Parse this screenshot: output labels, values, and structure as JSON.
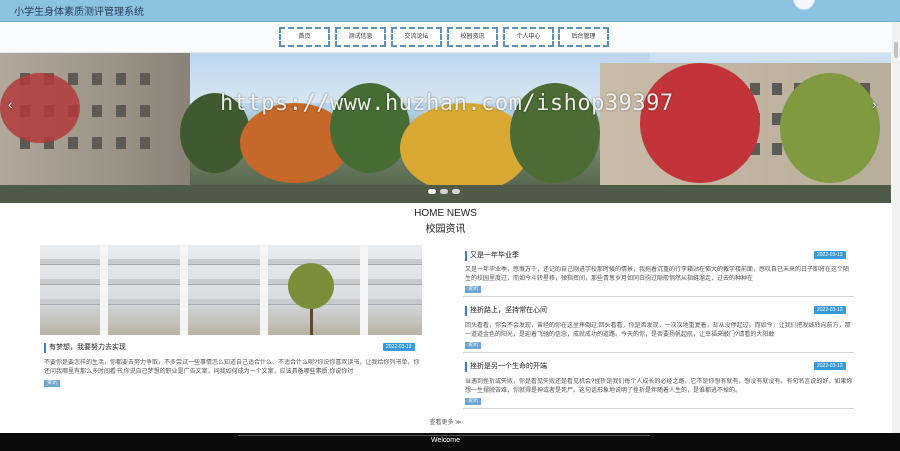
{
  "header": {
    "site_title": "小学生身体素质测评管理系统"
  },
  "nav": {
    "items": [
      "首页",
      "测试信息",
      "交流论坛",
      "校园资讯",
      "个人中心",
      "后台管理"
    ]
  },
  "banner": {
    "watermark": "https://www.huzhan.com/ishop39397",
    "prev_glyph": "‹",
    "next_glyph": "›",
    "slide_count": 3
  },
  "section": {
    "title_en": "HOME NEWS",
    "title_cn": "校园资讯"
  },
  "featured": {
    "title": "有梦想，我要努力去实现",
    "date": "2022-03-13",
    "excerpt": "不要你是要怎样的生活，你都要去努力争取，不多尝试一些事情怎么知道自己适合什么、不适合什么呢?你说你喜欢读书，让我给你列书单，你还问我哪里有那么多时间看书;你说自己梦想的职业是广告文案，问我如何成为一个文案，应该具备哪些素质;你说你讨",
    "tag": "资讯"
  },
  "news": [
    {
      "title": "又是一年毕业季",
      "date": "2022-03-13",
      "excerpt": "又是一年毕业季，感慨万千，还记的自己刚进学校那时候的情景，我拖着沉重的行李箱站在偌大的教学楼前面，感叹自己未来的日子即将在这个陌生的校园里度过，而如今斗转星移，弹指挥间，那些青葱岁月如同白驹过隙般悄然从指缝溜走，过去的种种在",
      "tag": "资讯"
    },
    {
      "title": "挫折路上，坚持常在心间",
      "date": "2022-03-13",
      "excerpt": "回头看看，你会不会发现，曾经的你在这里摔倒过;回头看看，你是否发现，一次次地重复着，却从没停起过。而如今，让我们把视线转向前方，那一道道金色的阳光，是迎着飞驰的信念，成就成功的道路。今天的你，是否要扬帆起航，让幸福来敲门?请看的大阳敢",
      "tag": "资讯"
    },
    {
      "title": "挫折是另一个生命的开端",
      "date": "2022-03-13",
      "excerpt": "当遇到挫折或失败，你是看见失败还是看见机会?挫折是我们每个人成长的必经之路，它不是你想有就有，想没有就没有。有句名言说的好，如果你想一生摆脱苦难，你就得是神或者是死尸。这句话形象地说明了挫折是伴随着人生的，是谁都逃不掉的。",
      "tag": "资讯"
    }
  ],
  "more_link": "查看更多 ≫",
  "footer": {
    "text": "Welcome"
  },
  "colors": {
    "topbar": "#8cc2e2",
    "nav_border": "#5f8fbd",
    "date_badge": "#3a9ad9",
    "tag": "#6ba6d6",
    "footer": "#0b0b0b"
  }
}
